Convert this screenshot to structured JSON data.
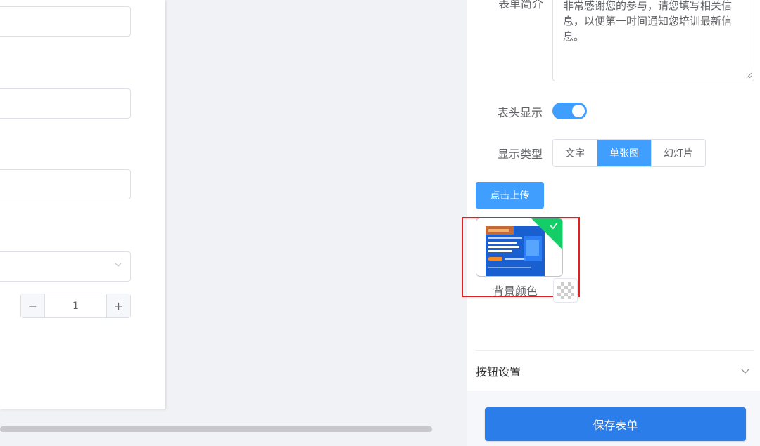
{
  "form": {
    "description_label": "表单简介",
    "description_value": "非常感谢您的参与，请您填写相关信息，以便第一时间通知您培训最新信息。",
    "header_display_label": "表头显示",
    "header_display_on": true,
    "display_type_label": "显示类型",
    "display_type_options": [
      "文字",
      "单张图",
      "幻灯片"
    ],
    "display_type_selected": "单张图",
    "upload_label": "点击上传",
    "upload_status": "success",
    "bg_color_label": "背景颜色",
    "bg_color_value": "transparent"
  },
  "preview": {
    "stepper_value": "1",
    "stepper_minus": "−",
    "stepper_plus": "+"
  },
  "sections": {
    "button_settings_title": "按钮设置"
  },
  "footer": {
    "save_label": "保存表单"
  },
  "colors": {
    "primary": "#409eff",
    "save_button": "#2b7de9",
    "success": "#13ce66",
    "highlight": "#e02020"
  },
  "icons": {
    "select": "chevron-down-icon",
    "upload_success": "check-icon",
    "collapse": "chevron-down-icon"
  }
}
